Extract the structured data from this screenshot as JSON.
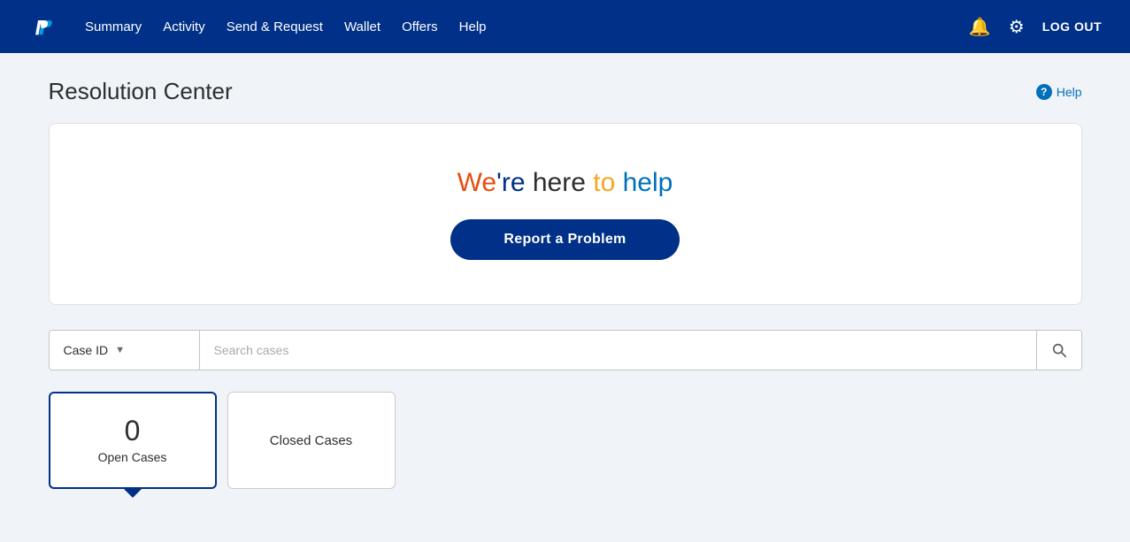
{
  "navbar": {
    "logo_alt": "PayPal",
    "links": [
      {
        "id": "summary",
        "label": "Summary"
      },
      {
        "id": "activity",
        "label": "Activity"
      },
      {
        "id": "send-request",
        "label": "Send & Request"
      },
      {
        "id": "wallet",
        "label": "Wallet"
      },
      {
        "id": "offers",
        "label": "Offers"
      },
      {
        "id": "help",
        "label": "Help"
      }
    ],
    "logout_label": "LOG OUT",
    "bell_icon": "🔔",
    "gear_icon": "⚙"
  },
  "page": {
    "title": "Resolution Center",
    "help_label": "Help",
    "hero": {
      "title_we": "We're",
      "title_here": " here ",
      "title_to": "to ",
      "title_help": "help",
      "report_btn": "Report a Problem"
    },
    "search": {
      "dropdown_label": "Case ID",
      "placeholder": "Search cases",
      "chevron": "▼"
    },
    "tabs": [
      {
        "id": "open",
        "count": "0",
        "label": "Open Cases",
        "active": true
      },
      {
        "id": "closed",
        "label": "Closed Cases",
        "active": false
      }
    ]
  }
}
